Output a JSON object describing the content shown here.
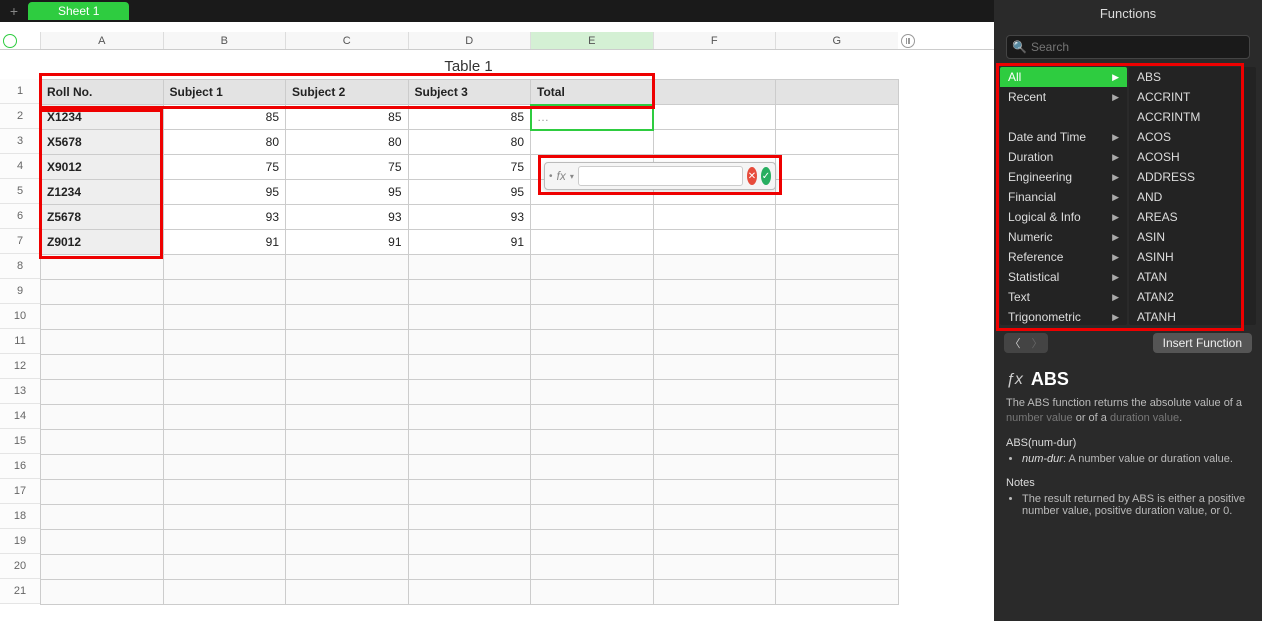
{
  "tabs": {
    "sheet1": "Sheet 1"
  },
  "columns": [
    "A",
    "B",
    "C",
    "D",
    "E",
    "F",
    "G"
  ],
  "table_title": "Table 1",
  "headers": {
    "rollno": "Roll No.",
    "s1": "Subject 1",
    "s2": "Subject 2",
    "s3": "Subject 3",
    "total": "Total"
  },
  "rows": [
    {
      "roll": "X1234",
      "s1": 85,
      "s2": 85,
      "s3": 85
    },
    {
      "roll": "X5678",
      "s1": 80,
      "s2": 80,
      "s3": 80
    },
    {
      "roll": "X9012",
      "s1": 75,
      "s2": 75,
      "s3": 75
    },
    {
      "roll": "Z1234",
      "s1": 95,
      "s2": 95,
      "s3": 95
    },
    {
      "roll": "Z5678",
      "s1": 93,
      "s2": 93,
      "s3": 93
    },
    {
      "roll": "Z9012",
      "s1": 91,
      "s2": 91,
      "s3": 91
    }
  ],
  "editing_cell_display": "…",
  "formula_editor": {
    "value": "",
    "fx_label": "fx"
  },
  "sidebar": {
    "title": "Functions",
    "search_placeholder": "Search",
    "categories": [
      "All",
      "Recent",
      "",
      "Date and Time",
      "Duration",
      "Engineering",
      "Financial",
      "Logical & Info",
      "Numeric",
      "Reference",
      "Statistical",
      "Text",
      "Trigonometric"
    ],
    "selected_category": "All",
    "functions": [
      "ABS",
      "ACCRINT",
      "ACCRINTM",
      "ACOS",
      "ACOSH",
      "ADDRESS",
      "AND",
      "AREAS",
      "ASIN",
      "ASINH",
      "ATAN",
      "ATAN2",
      "ATANH"
    ],
    "insert_label": "Insert Function",
    "detail": {
      "name": "ABS",
      "desc_pre": "The ABS function returns the absolute value of a ",
      "desc_link1": "number value",
      "desc_mid": " or of a ",
      "desc_link2": "duration value",
      "desc_post": ".",
      "signature": "ABS(num-dur)",
      "arg_name": "num-dur",
      "arg_desc": ": A number value or duration value.",
      "notes_h": "Notes",
      "note1": "The result returned by ABS is either a positive number value, positive duration value, or 0."
    }
  },
  "rownumbers": [
    "1",
    "2",
    "3",
    "4",
    "5",
    "6",
    "7",
    "8",
    "9",
    "10",
    "11",
    "12",
    "13",
    "14",
    "15",
    "16",
    "17",
    "18",
    "19",
    "20",
    "21"
  ]
}
